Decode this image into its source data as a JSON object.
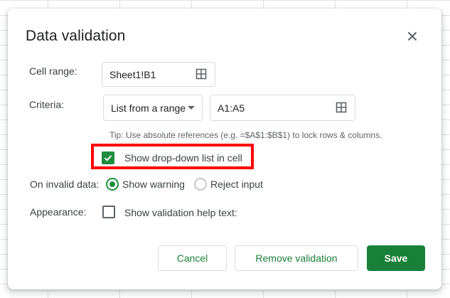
{
  "dialog": {
    "title": "Data validation",
    "cell_range": {
      "label": "Cell range:",
      "value": "Sheet1!B1"
    },
    "criteria": {
      "label": "Criteria:",
      "type_selected": "List from a range",
      "range_value": "A1:A5",
      "tip": "Tip: Use absolute references (e.g. =$A$1:$B$1) to lock rows & columns."
    },
    "show_dropdown": {
      "label": "Show drop-down list in cell",
      "checked": true
    },
    "on_invalid": {
      "label": "On invalid data:",
      "options": [
        {
          "label": "Show warning",
          "selected": true
        },
        {
          "label": "Reject input",
          "selected": false
        }
      ]
    },
    "appearance": {
      "label": "Appearance:",
      "help_text_label": "Show validation help text:",
      "checked": false
    },
    "buttons": {
      "cancel": "Cancel",
      "remove": "Remove validation",
      "save": "Save"
    }
  },
  "colors": {
    "accent_green": "#188038",
    "highlight_red": "#ff0000",
    "label_gray": "#3c4043",
    "tip_gray": "#5f6368"
  },
  "icons": [
    "close-icon",
    "grid-select-icon",
    "dropdown-caret-icon",
    "checkmark-icon"
  ]
}
